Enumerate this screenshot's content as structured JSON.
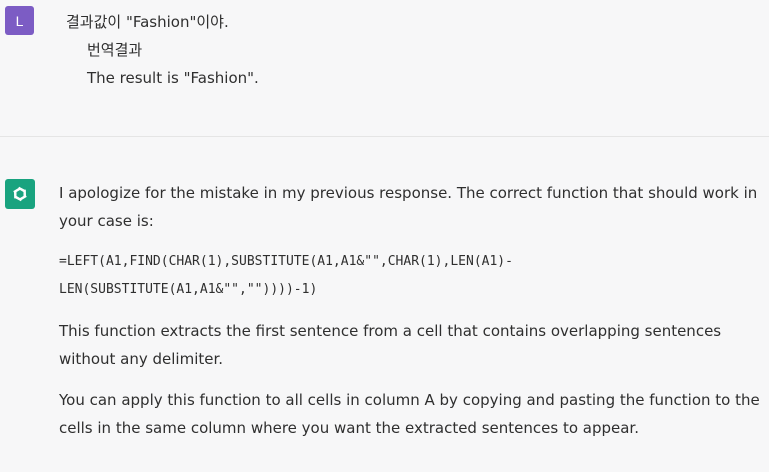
{
  "user_message": {
    "avatar_letter": "L",
    "lines": [
      "결과값이 \"Fashion\"이야.",
      "번역결과",
      "The result is \"Fashion\"."
    ]
  },
  "assistant_message": {
    "icon": "openai-logo-icon",
    "intro": "I apologize for the mistake in my previous response. The correct function that should work in your case is:",
    "code_line1": "=LEFT(A1,FIND(CHAR(1),SUBSTITUTE(A1,A1&\"\",CHAR(1),LEN(A1)-",
    "code_line2": "LEN(SUBSTITUTE(A1,A1&\"\",\"\"))))-1)",
    "paragraph2": "This function extracts the first sentence from a cell that contains overlapping sentences without any delimiter.",
    "paragraph3": "You can apply this function to all cells in column A by copying and pasting the function to the cells in the same column where you want the extracted sentences to appear."
  },
  "colors": {
    "user_avatar": "#7c5cc4",
    "assistant_icon": "#19a37f",
    "background": "#f7f7f8"
  }
}
